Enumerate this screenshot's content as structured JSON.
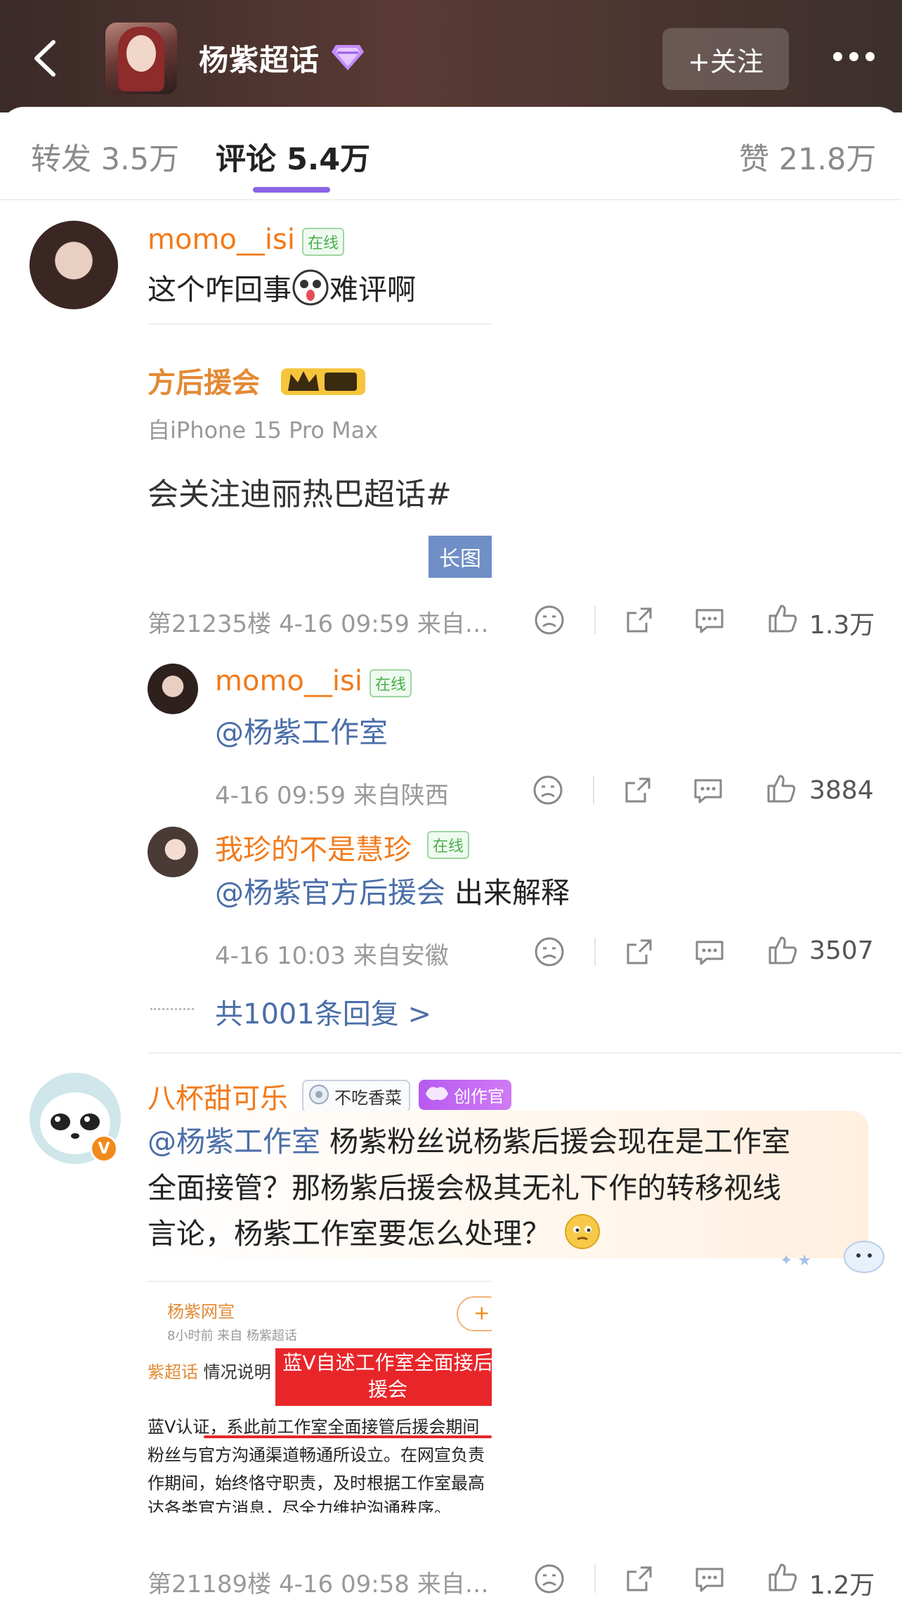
{
  "header": {
    "title": "杨紫超话",
    "follow_label": "+关注"
  },
  "tabs": [
    {
      "label": "转发 3.5万"
    },
    {
      "label": "评论 5.4万"
    },
    {
      "label": "赞 21.8万"
    }
  ],
  "comments": [
    {
      "user": "momo__isi",
      "online": "在线",
      "text_a": "这个咋回事",
      "text_b": "难评啊",
      "image": {
        "line1": "方后援会",
        "line2": "自iPhone 15 Pro Max",
        "line3": "会关注迪丽热巴超话#",
        "tag": "长图"
      },
      "meta": "第21235楼 4-16 09:59 来自…",
      "likes": "1.3万"
    },
    {
      "user": "八杯甜可乐",
      "badge1": "不吃香菜",
      "badge2": "创作官",
      "mention": "@杨紫工作室",
      "text_line1": " 杨紫粉丝说杨紫后援会现在是工作室",
      "text_line2": "全面接管？那杨紫后援会极其无礼下作的转移视线",
      "text_line3": "言论，杨紫工作室要怎么处理？",
      "image": {
        "name": "杨紫网宣",
        "sub": "8小时前  来自 杨紫超话",
        "plus": "+",
        "l1a": "紫超话",
        "l1b": " 情况说明",
        "redbox": "蓝V自述工作室全面接后援会",
        "l2": "蓝V认证，系此前工作室全面接管后援会期间",
        "l3": "粉丝与官方沟通渠道畅通所设立。在网宣负责",
        "l4": "作期间，始终恪守职责，及时根据工作室最高",
        "l5": "达各类官方消息，尽全力维护沟通秩序。"
      },
      "meta": "第21189楼 4-16 09:58 来自…",
      "likes": "1.2万"
    }
  ],
  "replies": [
    {
      "user": "momo__isi",
      "online": "在线",
      "mention": "@杨紫工作室",
      "text": "",
      "meta": "4-16 09:59 来自陕西",
      "likes": "3884"
    },
    {
      "user": "我珍的不是慧珍",
      "online": "在线",
      "mention": "@杨紫官方后援会",
      "text": " 出来解释",
      "meta": "4-16 10:03 来自安徽",
      "likes": "3507"
    }
  ],
  "more_replies": "共1001条回复 >",
  "icons": [
    "back-icon",
    "gem-icon",
    "more-icon",
    "dislike-icon",
    "share-icon",
    "comment-icon",
    "like-icon"
  ],
  "colors": {
    "accent": "#8a63e6",
    "username": "#f27a1a",
    "mention": "#4a6ea8",
    "header_bg": "#4a3430"
  }
}
